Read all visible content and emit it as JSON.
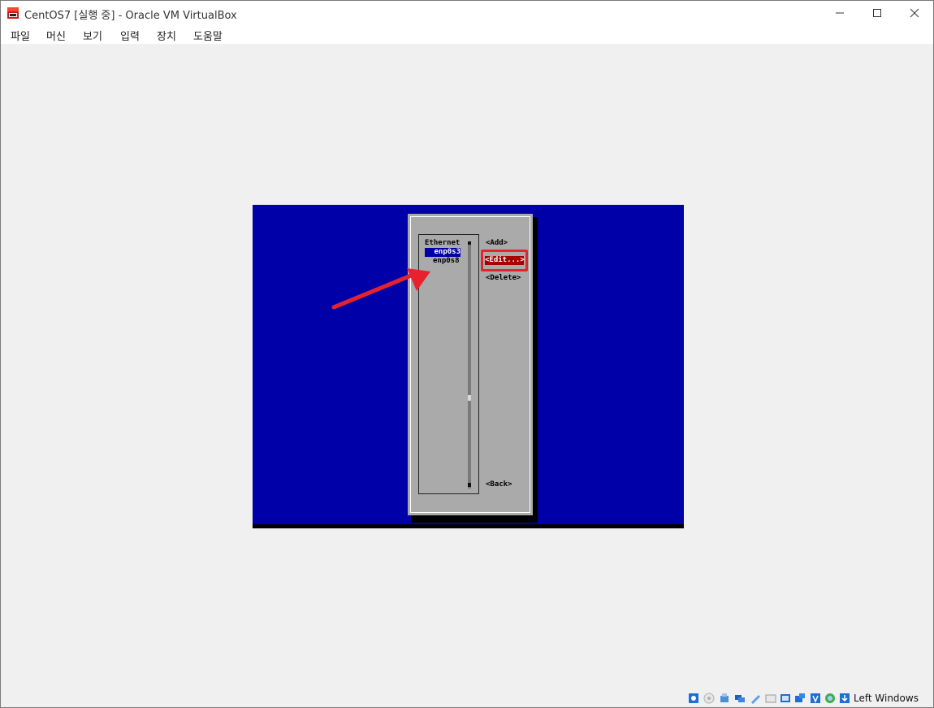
{
  "window": {
    "title": "CentOS7 [실행 중] - Oracle VM VirtualBox"
  },
  "menu": {
    "items": [
      "파일",
      "머신",
      "보기",
      "입력",
      "장치",
      "도움말"
    ]
  },
  "tui": {
    "category": "Ethernet",
    "connections": [
      "enp0s3",
      "enp0s8"
    ],
    "buttons": {
      "add": "<Add>",
      "edit": "<Edit...>",
      "delete": "<Delete>",
      "back": "<Back>"
    }
  },
  "colors": {
    "vm_background": "#0000a8",
    "dialog": "#aaaaaa",
    "focus_button": "#a80000",
    "annotation": "#e8212e"
  },
  "statusbar": {
    "icons": [
      "hard-disk-icon",
      "optical-drive-icon",
      "audio-icon",
      "network-icon",
      "usb-icon",
      "shared-folders-icon",
      "display-icon",
      "video-capture-icon",
      "virtualization-icon",
      "mouse-integration-icon",
      "keyboard-capture-icon"
    ],
    "host_key": "Left Windows"
  }
}
